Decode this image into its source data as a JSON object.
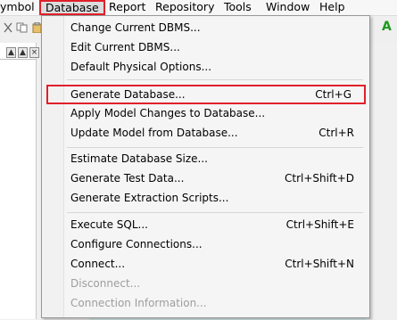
{
  "menubar": {
    "items": [
      "ymbol",
      "Database",
      "Report",
      "Repository",
      "Tools",
      "Window",
      "Help"
    ]
  },
  "toolbar": {
    "right_icon_text": "A"
  },
  "left_pane": {
    "buttons": [
      "▲",
      "▲",
      "×"
    ]
  },
  "database_menu": {
    "groups": [
      [
        {
          "label": "Change Current DBMS...",
          "shortcut": ""
        },
        {
          "label": "Edit Current DBMS...",
          "shortcut": ""
        },
        {
          "label": "Default Physical Options...",
          "shortcut": ""
        }
      ],
      [
        {
          "label": "Generate Database...",
          "shortcut": "Ctrl+G"
        },
        {
          "label": "Apply Model Changes to Database...",
          "shortcut": ""
        },
        {
          "label": "Update Model from Database...",
          "shortcut": "Ctrl+R"
        }
      ],
      [
        {
          "label": "Estimate Database Size...",
          "shortcut": ""
        },
        {
          "label": "Generate Test Data...",
          "shortcut": "Ctrl+Shift+D"
        },
        {
          "label": "Generate Extraction Scripts...",
          "shortcut": ""
        }
      ],
      [
        {
          "label": "Execute SQL...",
          "shortcut": "Ctrl+Shift+E"
        },
        {
          "label": "Configure Connections...",
          "shortcut": ""
        },
        {
          "label": "Connect...",
          "shortcut": "Ctrl+Shift+N"
        },
        {
          "label": "Disconnect...",
          "shortcut": ""
        },
        {
          "label": "Connection Information...",
          "shortcut": ""
        }
      ]
    ]
  }
}
